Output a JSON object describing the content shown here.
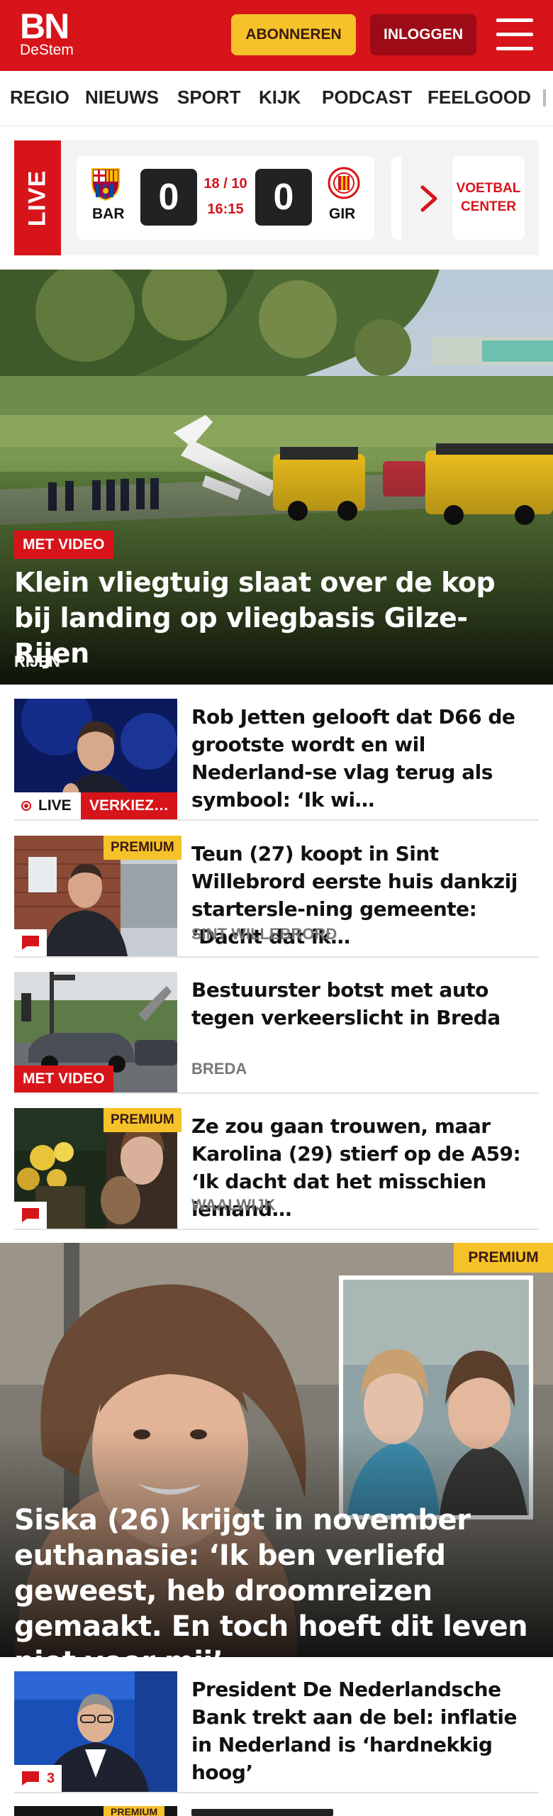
{
  "header": {
    "logo_main": "BN",
    "logo_sub": "DeStem",
    "subscribe_label": "ABONNEREN",
    "login_label": "INLOGGEN",
    "menu_icon": "hamburger-menu-icon"
  },
  "nav": {
    "items": [
      "REGIO",
      "NIEUWS",
      "SPORT",
      "KIJK",
      "PODCAST",
      "FEELGOOD"
    ]
  },
  "live_widget": {
    "label": "LIVE",
    "match": {
      "home_code": "BAR",
      "home_score": "0",
      "date": "18 / 10",
      "time": "16:15",
      "away_score": "0",
      "away_code": "GIR"
    },
    "next_icon": "chevron-right-icon",
    "center_label_line1": "VOETBAL",
    "center_label_line2": "CENTER"
  },
  "hero": {
    "tag": "MET VIDEO",
    "title": "Klein vliegtuig slaat over de kop bij landing op vliegbasis Gilze-Rijen",
    "location": "RIJEN"
  },
  "articles": [
    {
      "title": "Rob Jetten gelooft dat D66 de grootste wordt en wil Nederland-se vlag terug als symbool: ‘Ik wi…",
      "live_label": "LIVE",
      "tag": "VERKIEZ…"
    },
    {
      "title": "Teun (27) koopt in Sint Willebrord eerste huis dankzij startersle-ning gemeente: ‘Dacht dat ik…",
      "premium": "PREMIUM",
      "location": "SINT WILLEBRORD",
      "comment_icon": "comment-icon"
    },
    {
      "title": "Bestuurster botst met auto tegen verkeerslicht in Breda",
      "tag": "MET VIDEO",
      "location": "BREDA"
    },
    {
      "title": "Ze zou gaan trouwen, maar Karolina (29) stierf op de A59: ‘Ik dacht dat het misschien iemand…",
      "premium": "PREMIUM",
      "location": "WAALWIJK",
      "comment_icon": "comment-icon"
    }
  ],
  "feature": {
    "premium": "PREMIUM",
    "title": "Siska (26) krijgt in november euthanasie: ‘Ik ben verliefd geweest, heb droomreizen gemaakt. En toch hoeft dit leven niet voor mij’"
  },
  "article_last": {
    "title": "President De Nederlandsche Bank trekt aan de bel: inflatie in Nederland is ‘hardnekkig hoog’",
    "comment_count": "3",
    "comment_icon": "comment-icon"
  },
  "next_teaser": {
    "premium": "PREMIUM"
  },
  "colors": {
    "brand_red": "#d7141a",
    "premium_yellow": "#f5c22a",
    "login_dark_red": "#9c0b16"
  }
}
